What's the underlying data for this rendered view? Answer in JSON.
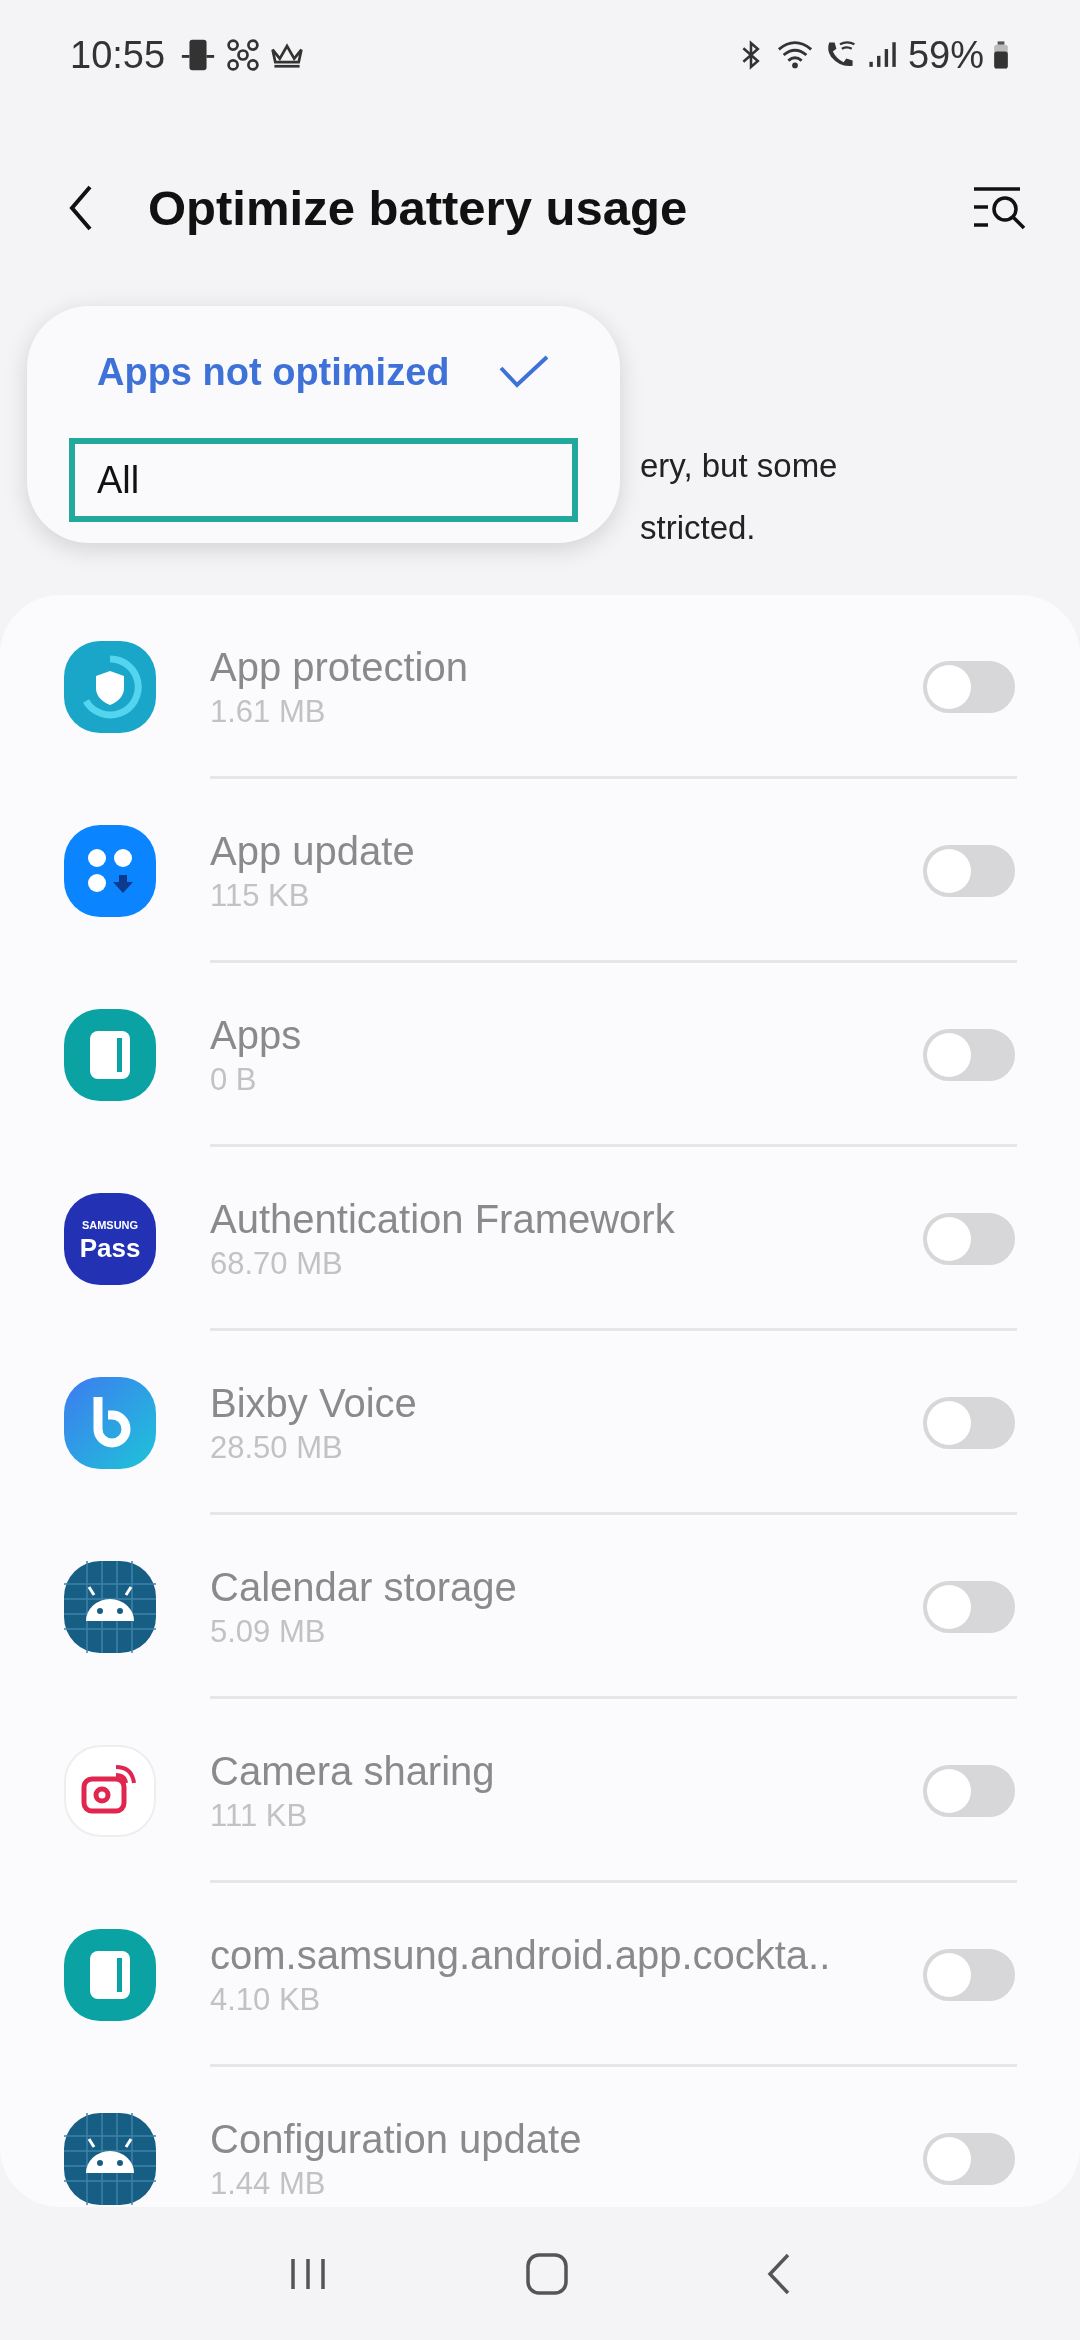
{
  "status_bar": {
    "time": "10:55",
    "battery": "59%"
  },
  "toolbar": {
    "title": "Optimize battery usage"
  },
  "description_fragments": [
    "ery, but some",
    "stricted."
  ],
  "filter_menu": {
    "items": [
      {
        "label": "Apps not optimized",
        "selected": true,
        "focused": false
      },
      {
        "label": "All",
        "selected": false,
        "focused": true
      }
    ]
  },
  "apps": [
    {
      "name": "App protection",
      "size": "1.61 MB",
      "kind": "shield",
      "checked": false
    },
    {
      "name": "App update",
      "size": "115 KB",
      "kind": "dots",
      "checked": false
    },
    {
      "name": "Apps",
      "size": "0 B",
      "kind": "panel",
      "checked": false
    },
    {
      "name": "Authentication Framework",
      "size": "68.70 MB",
      "kind": "pass",
      "icon_text": [
        "SAMSUNG",
        "Pass"
      ],
      "checked": false
    },
    {
      "name": "Bixby Voice",
      "size": "28.50 MB",
      "kind": "bixby",
      "checked": false
    },
    {
      "name": "Calendar storage",
      "size": "5.09 MB",
      "kind": "android",
      "checked": false
    },
    {
      "name": "Camera sharing",
      "size": "111 KB",
      "kind": "camera",
      "checked": false
    },
    {
      "name": "com.samsung.android.app.cockta..",
      "size": "4.10 KB",
      "kind": "panel",
      "checked": false
    },
    {
      "name": "Configuration update",
      "size": "1.44 MB",
      "kind": "android",
      "checked": false
    }
  ]
}
